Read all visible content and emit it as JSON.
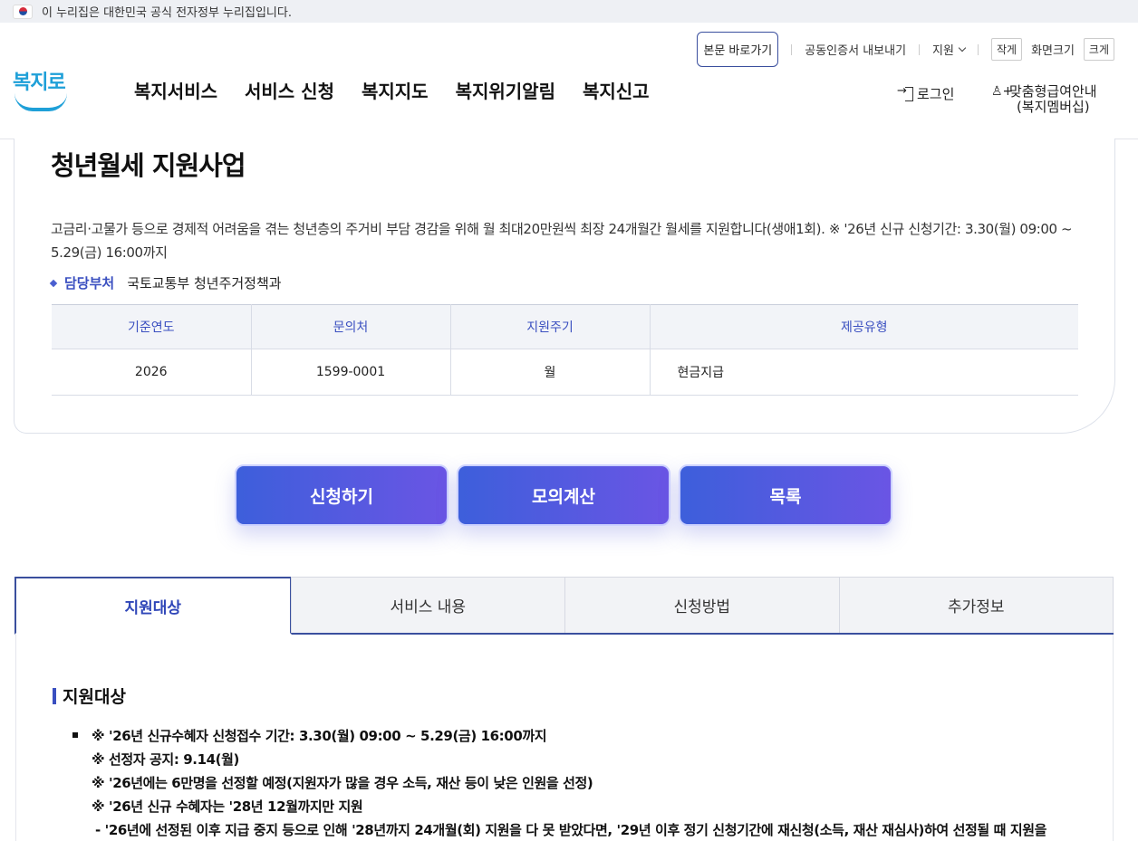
{
  "gov_banner": {
    "text": "이 누리집은 대한민국 공식 전자정부 누리집입니다."
  },
  "util": {
    "skip": "본문 바로가기",
    "cert": "공동인증서 내보내기",
    "support": "지원",
    "small": "작게",
    "size_label": "화면크기",
    "large": "크게"
  },
  "logo": {
    "text": "복지로"
  },
  "gnb": [
    "복지서비스",
    "서비스 신청",
    "복지지도",
    "복지위기알림",
    "복지신고"
  ],
  "login": "로그인",
  "member": {
    "line1": "맞춤형급여안내",
    "line2": "(복지멤버십)"
  },
  "service": {
    "title": "청년월세 지원사업",
    "desc": "고금리·고물가 등으로 경제적 어려움을 겪는 청년층의 주거비 부담 경감을 위해 월 최대20만원씩 최장 24개월간 월세를 지원합니다(생애1회). ※ '26년 신규 신청기간: 3.30(월) 09:00 ~ 5.29(금) 16:00까지",
    "dept_label": "담당부처",
    "dept_value": "국토교통부 청년주거정책과"
  },
  "info_table": {
    "headers": [
      "기준연도",
      "문의처",
      "지원주기",
      "제공유형"
    ],
    "row": [
      "2026",
      "1599-0001",
      "월",
      "현금지급"
    ]
  },
  "actions": [
    "신청하기",
    "모의계산",
    "목록"
  ],
  "tabs": [
    "지원대상",
    "서비스 내용",
    "신청방법",
    "추가정보"
  ],
  "section": {
    "title": "지원대상",
    "lines": [
      "※ '26년 신규수혜자 신청접수 기간: 3.30(월) 09:00 ~ 5.29(금) 16:00까지",
      "※ 선정자 공지: 9.14(월)",
      "※ '26년에는 6만명을 선정할 예정(지원자가 많을 경우 소득, 재산 등이 낮은 인원을 선정)",
      "※ '26년 신규 수혜자는 '28년 12월까지만 지원",
      "- '26년에 선정된 이후 지급 중지 등으로 인해 '28년까지 24개월(회) 지원을 다 못 받았다면, '29년 이후 정기 신청기간에 재신청(소득, 재산 재심사)하여 선정될 때 지원을"
    ]
  }
}
